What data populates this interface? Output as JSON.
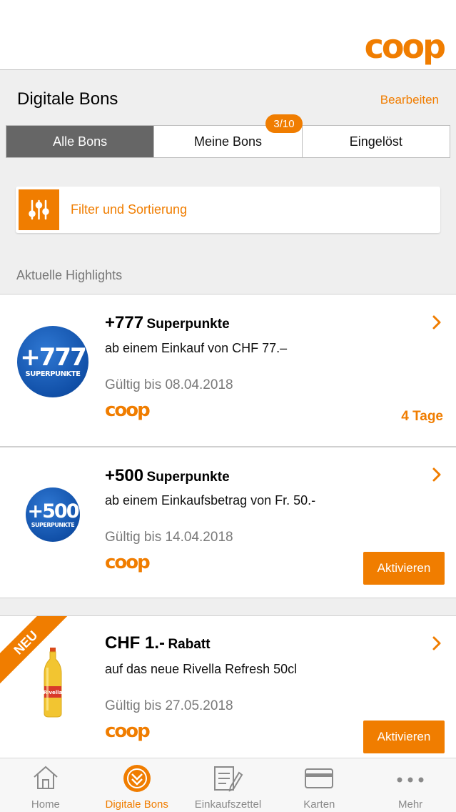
{
  "brand": {
    "logo_text": "coop",
    "accent": "#f07d00"
  },
  "header": {
    "title": "Digitale Bons",
    "edit_label": "Bearbeiten"
  },
  "segments": [
    {
      "label": "Alle Bons",
      "active": true
    },
    {
      "label": "Meine Bons",
      "active": false
    },
    {
      "label": "Eingelöst",
      "active": false
    }
  ],
  "my_bons_badge": "3/10",
  "filter": {
    "label": "Filter und Sortierung",
    "icon": "sliders-icon"
  },
  "section_label": "Aktuelle Highlights",
  "bons": [
    {
      "title_big": "+777",
      "title_small": "Superpunkte",
      "subtitle": "ab einem Einkauf von CHF 77.–",
      "valid": "Gültig bis 08.04.2018",
      "brand": "coop",
      "badge_num": "+777",
      "badge_label": "SUPERPUNKTE",
      "status": "4 Tage"
    },
    {
      "title_big": "+500",
      "title_small": "Superpunkte",
      "subtitle": "ab einem Einkaufsbetrag von Fr. 50.-",
      "valid": "Gültig bis 14.04.2018",
      "brand": "coop",
      "badge_num": "+500",
      "badge_label": "SUPERPUNKTE",
      "action": "Aktivieren"
    },
    {
      "ribbon": "NEU",
      "title_big": "CHF 1.-",
      "title_small": "Rabatt",
      "subtitle": "auf das neue Rivella Refresh 50cl",
      "valid": "Gültig bis 27.05.2018",
      "brand": "coop",
      "product_label": "Rivella",
      "action": "Aktivieren"
    }
  ],
  "tabs": [
    {
      "label": "Home",
      "icon": "home-icon",
      "active": false
    },
    {
      "label": "Digitale Bons",
      "icon": "digital-bons-icon",
      "active": true
    },
    {
      "label": "Einkaufszettel",
      "icon": "shopping-list-icon",
      "active": false
    },
    {
      "label": "Karten",
      "icon": "card-icon",
      "active": false
    },
    {
      "label": "Mehr",
      "icon": "more-icon",
      "active": false
    }
  ]
}
